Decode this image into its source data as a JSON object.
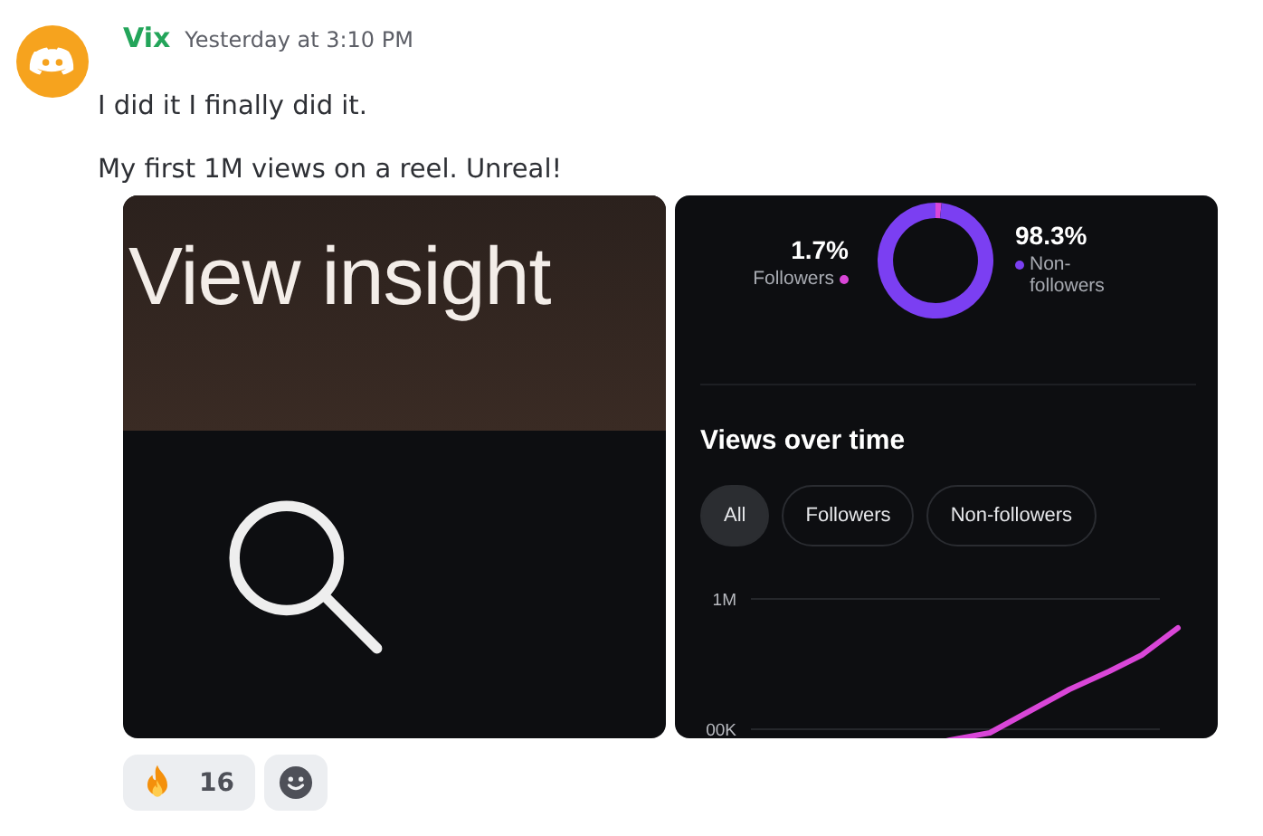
{
  "message": {
    "author": "Vix",
    "timestamp": "Yesterday at 3:10 PM",
    "lines": [
      "I did it I finally did it.",
      "My first 1M views on a reel. Unreal!"
    ]
  },
  "attachments": [
    {
      "kind": "insight_button",
      "title": "View insight"
    },
    {
      "kind": "insights_panel",
      "legend": [
        {
          "value": "1.7%",
          "color": "#d946d8"
        },
        {
          "value": "98.3%",
          "color": "#7b3ff2"
        }
      ],
      "donut": {
        "chart_data": {
          "type": "donut",
          "categories": [
            "Followers",
            "Non-\nfollowers"
          ],
          "values": [
            1.7,
            98.3
          ]
        }
      },
      "section_title": "Views over time",
      "filters": [
        {
          "label": "All",
          "selected": true
        },
        {
          "label": "Followers",
          "selected": false
        },
        {
          "label": "Non-followers",
          "selected": false
        }
      ],
      "views_chart": {
        "kind": "line_picture",
        "tick_labels": [
          "1M",
          "00K"
        ]
      }
    }
  ],
  "reactions": [
    {
      "kind": "fire",
      "count": "16"
    },
    {
      "kind": "add"
    }
  ]
}
